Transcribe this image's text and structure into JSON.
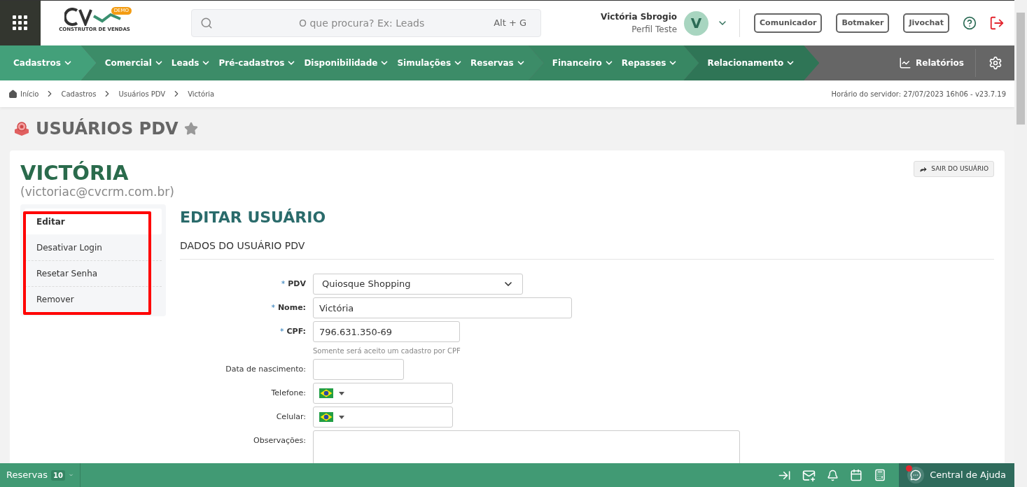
{
  "header": {
    "logo_badge": "DEMO",
    "logo_subtitle": "CONSTRUTOR DE VENDAS",
    "search": {
      "placeholder": "O que procura? Ex: Leads",
      "shortcut": "Alt + G"
    },
    "user": {
      "name": "Victória Sbrogio",
      "profile": "Perfil Teste",
      "initial": "V"
    },
    "buttons": [
      "Comunicador",
      "Botmaker",
      "Jivochat"
    ]
  },
  "nav": {
    "groups": [
      {
        "items": [
          "Cadastros"
        ]
      },
      {
        "items": [
          "Comercial",
          "Leads",
          "Pré-cadastros",
          "Disponibilidade",
          "Simulações",
          "Reservas"
        ]
      },
      {
        "items": [
          "Financeiro",
          "Repasses"
        ]
      },
      {
        "items": [
          "Relacionamento"
        ]
      }
    ],
    "reports": "Relatórios"
  },
  "breadcrumb": [
    "Início",
    "Cadastros",
    "Usuários PDV",
    "Victória"
  ],
  "server_time": "Horário do servidor: 27/07/2023 16h06 - v23.7.19",
  "page_title": "USUÁRIOS PDV",
  "user_card": {
    "name": "VICTÓRIA",
    "email": "(victoriac@cvcrm.com.br)",
    "exit_button": "SAIR DO USUÁRIO"
  },
  "side_menu": {
    "highlighted": true,
    "items": [
      {
        "label": "Editar",
        "selected": true
      },
      {
        "label": "Desativar Login",
        "selected": false
      },
      {
        "label": "Resetar Senha",
        "selected": false
      },
      {
        "label": "Remover",
        "selected": false
      }
    ]
  },
  "form": {
    "title": "EDITAR USUÁRIO",
    "section": "DADOS DO USUÁRIO PDV",
    "fields": [
      {
        "kind": "select",
        "label": "PDV",
        "required_mark": "*",
        "value": "Quiosque Shopping"
      },
      {
        "kind": "text",
        "label": "Nome:",
        "required_mark": "*",
        "value": "Victória"
      },
      {
        "kind": "text",
        "label": "CPF:",
        "required_mark": "*",
        "value": "796.631.350-69",
        "hint": "Somente será aceito um cadastro por CPF"
      },
      {
        "kind": "date",
        "label": "Data de nascimento:"
      },
      {
        "kind": "phone",
        "label": "Telefone:"
      },
      {
        "kind": "phone",
        "label": "Celular:"
      },
      {
        "kind": "textarea",
        "label": "Observações:"
      }
    ]
  },
  "bottom_bar": {
    "reservations": {
      "label": "Reservas",
      "count": "10"
    },
    "help": {
      "label": "Central de Ajuda",
      "notification": true
    }
  }
}
